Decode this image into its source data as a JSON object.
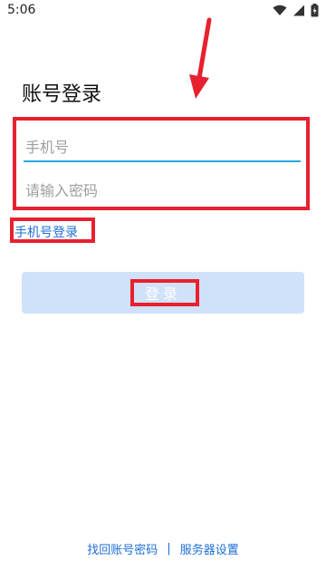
{
  "status_bar": {
    "time": "5:06",
    "icons": [
      "wifi-icon",
      "cellular-icon",
      "battery-charging-icon"
    ]
  },
  "login": {
    "title": "账号登录",
    "phone_placeholder": "手机号",
    "password_placeholder": "请输入密码",
    "switch_label": "手机号登录",
    "button_label": "登录"
  },
  "footer": {
    "recover_label": "找回账号密码",
    "separator": "|",
    "server_settings_label": "服务器设置"
  },
  "colors": {
    "accent": "#1e6fd6",
    "underline": "#29a7e1",
    "button_bg": "#cfe2fa",
    "annotation": "#e8202f"
  }
}
